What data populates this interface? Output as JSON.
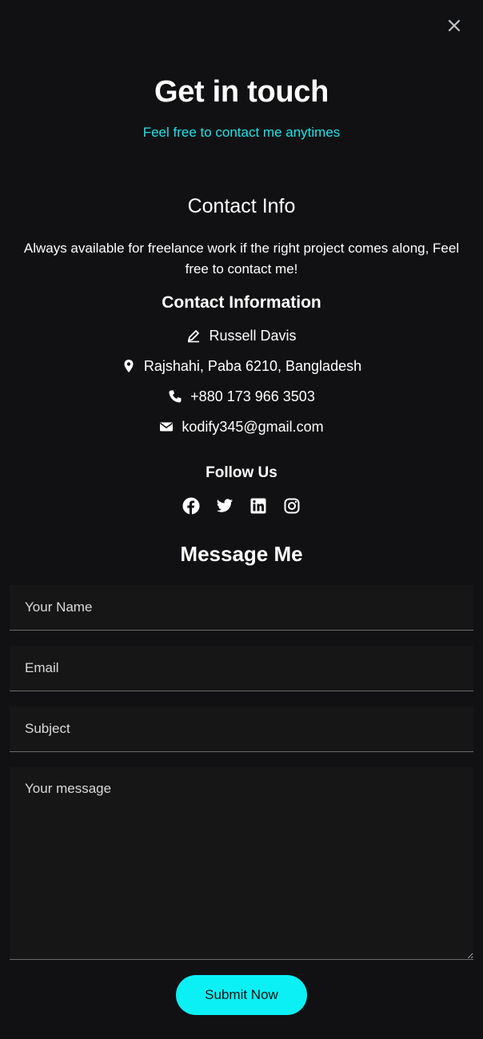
{
  "close": {
    "icon": "close-icon"
  },
  "hero": {
    "title": "Get in touch",
    "subtitle": "Feel free to contact me anytimes"
  },
  "contact_info": {
    "title": "Contact Info",
    "description": "Always available for freelance work if the right project comes along, Feel free to contact me!",
    "heading": "Contact Information",
    "items": [
      {
        "icon": "pen-icon",
        "text": "Russell Davis"
      },
      {
        "icon": "location-pin-icon",
        "text": "Rajshahi, Paba 6210, Bangladesh"
      },
      {
        "icon": "phone-icon",
        "text": "+880 173 966 3503"
      },
      {
        "icon": "envelope-icon",
        "text": "kodify345@gmail.com"
      }
    ]
  },
  "follow": {
    "title": "Follow Us",
    "icons": [
      "facebook-icon",
      "twitter-icon",
      "linkedin-icon",
      "instagram-icon"
    ]
  },
  "form": {
    "title": "Message Me",
    "name_placeholder": "Your Name",
    "email_placeholder": "Email",
    "subject_placeholder": "Subject",
    "message_placeholder": "Your message",
    "submit_label": "Submit Now"
  },
  "colors": {
    "background": "#111113",
    "accent": "#0af0f5",
    "subtitle": "#19e3ea",
    "field_bg": "#161616"
  }
}
